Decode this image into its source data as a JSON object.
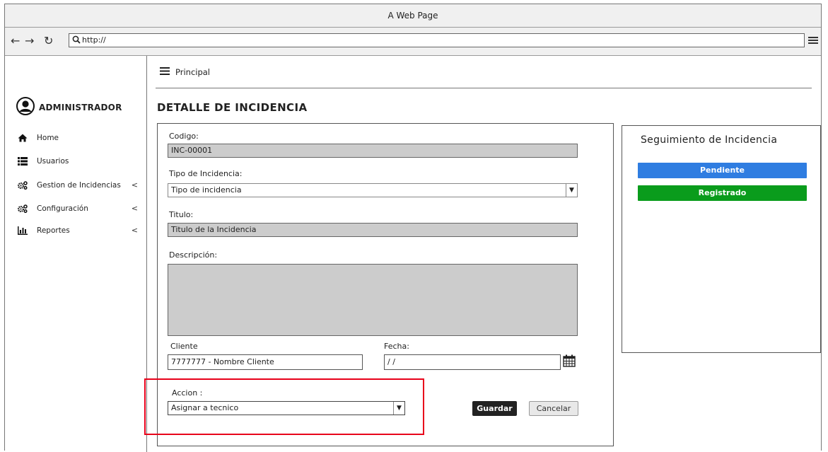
{
  "window": {
    "title": "A Web Page"
  },
  "address": {
    "url": "http://"
  },
  "sidebar": {
    "user": "ADMINISTRADOR",
    "items": [
      {
        "label": "Home",
        "icon": "home-icon"
      },
      {
        "label": "Usuarios",
        "icon": "list-icon"
      },
      {
        "label": "Gestion de Incidencias",
        "icon": "gears-icon",
        "chevron": "<"
      },
      {
        "label": "Configuración",
        "icon": "gears-icon",
        "chevron": "<"
      },
      {
        "label": "Reportes",
        "icon": "bar-chart-icon",
        "chevron": "<"
      }
    ]
  },
  "breadcrumb": {
    "label": "Principal"
  },
  "page": {
    "title": "DETALLE DE INCIDENCIA"
  },
  "form": {
    "codigo_label": "Codigo:",
    "codigo_value": "INC-00001",
    "tipo_label": "Tipo de Incidencia:",
    "tipo_value": "Tipo de incidencia",
    "titulo_label": "Titulo:",
    "titulo_value": "Titulo de la Incidencia",
    "descripcion_label": "Descripción:",
    "descripcion_value": "",
    "cliente_label": "Cliente",
    "cliente_value": "7777777 - Nombre Cliente",
    "fecha_label": "Fecha:",
    "fecha_value": " / /",
    "accion_label": "Accion :",
    "accion_value": "Asignar a tecnico",
    "guardar_label": "Guardar",
    "cancelar_label": "Cancelar"
  },
  "seguimiento": {
    "title": "Seguimiento de Incidencia",
    "statuses": [
      {
        "label": "Pendiente",
        "color": "#2f7de1"
      },
      {
        "label": "Registrado",
        "color": "#0a9c1c"
      }
    ]
  },
  "colors": {
    "highlight": "#e8001a",
    "readonly_field": "#cccccc"
  }
}
